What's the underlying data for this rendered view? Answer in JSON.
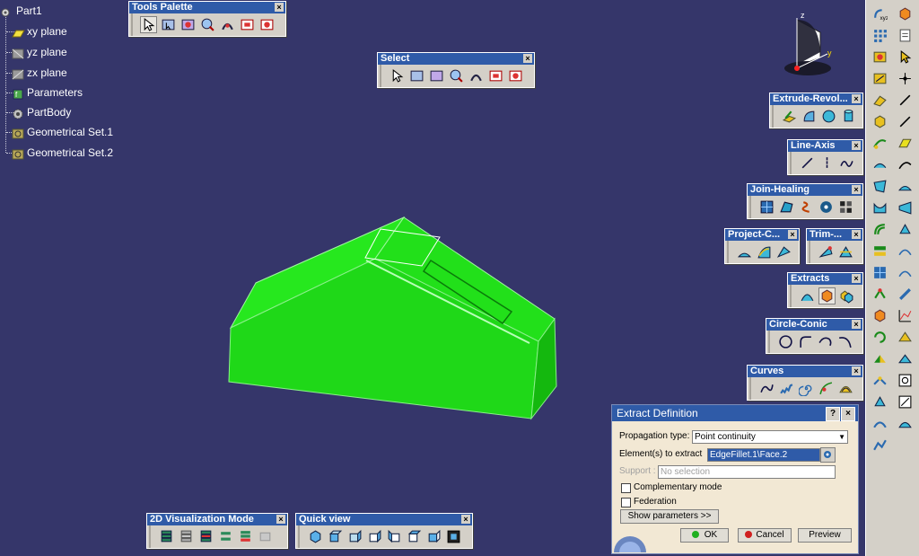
{
  "tree": {
    "root": "Part1",
    "items": [
      {
        "label": "xy plane",
        "icon": "plane-icon"
      },
      {
        "label": "yz plane",
        "icon": "plane-icon"
      },
      {
        "label": "zx plane",
        "icon": "plane-icon"
      },
      {
        "label": "Parameters",
        "icon": "parameters-icon"
      },
      {
        "label": "PartBody",
        "icon": "gear-icon"
      },
      {
        "label": "Geometrical Set.1",
        "icon": "geometrical-set-icon"
      },
      {
        "label": "Geometrical Set.2",
        "icon": "geometrical-set-icon"
      }
    ]
  },
  "toolbars": {
    "tools_palette": "Tools Palette",
    "select": "Select",
    "extrude_revol": "Extrude-Revol...",
    "line_axis": "Line-Axis",
    "join_healing": "Join-Healing",
    "project_c": "Project-C...",
    "trim": "Trim-...",
    "extracts": "Extracts",
    "circle_conic": "Circle-Conic",
    "curves": "Curves",
    "viz_mode": "2D Visualization Mode",
    "quick_view": "Quick view",
    "close_glyph": "×"
  },
  "compass": {
    "z": "z",
    "y": "y"
  },
  "dialog": {
    "title": "Extract Definition",
    "help_glyph": "?",
    "close_glyph": "×",
    "propagation_label": "Propagation type:",
    "propagation_value": "Point continuity",
    "elements_label": "Element(s) to extract",
    "elements_value": "EdgeFillet.1\\Face.2",
    "support_label": "Support :",
    "support_value": "No selection",
    "complementary_label": "Complementary mode",
    "federation_label": "Federation",
    "show_params": "Show parameters >>",
    "ok": "OK",
    "cancel": "Cancel",
    "preview": "Preview"
  },
  "colors": {
    "background": "#35366a",
    "part_fill": "#22e61a",
    "title_bar": "#2f5ba8",
    "dialog_bg": "#f2e8d4"
  }
}
